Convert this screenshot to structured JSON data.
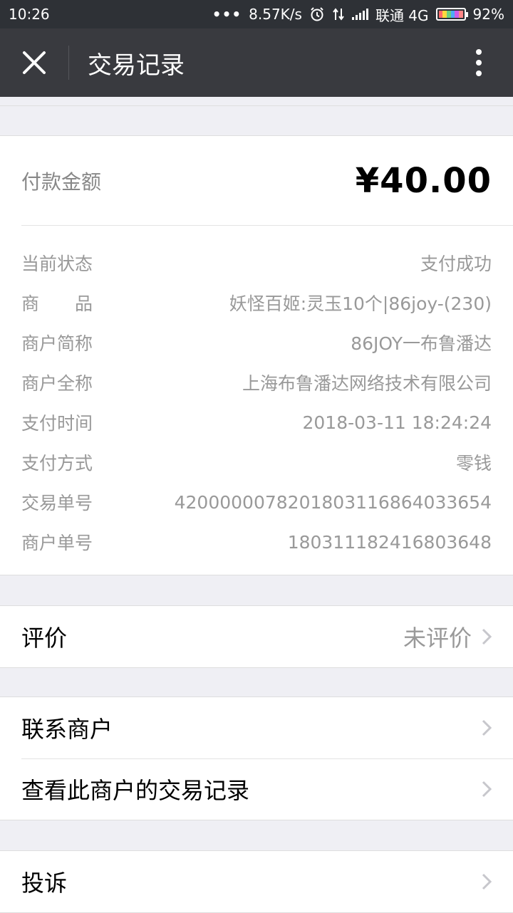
{
  "status_bar": {
    "time": "10:26",
    "dots": "•••",
    "speed": "8.57K/s",
    "carrier": "联通 4G",
    "battery": "92%"
  },
  "nav": {
    "title": "交易记录"
  },
  "amount": {
    "label": "付款金额",
    "value": "¥40.00"
  },
  "details": [
    {
      "label": "当前状态",
      "value": "支付成功"
    },
    {
      "label": "商品",
      "value": "妖怪百姬:灵玉10个|86joy-(230)"
    },
    {
      "label": "商户简称",
      "value": "86JOY一布鲁潘达"
    },
    {
      "label": "商户全称",
      "value": "上海布鲁潘达网络技术有限公司"
    },
    {
      "label": "支付时间",
      "value": "2018-03-11 18:24:24"
    },
    {
      "label": "支付方式",
      "value": "零钱"
    },
    {
      "label": "交易单号",
      "value": "4200000078201803116864033654"
    },
    {
      "label": "商户单号",
      "value": "180311182416803648"
    }
  ],
  "rating": {
    "label": "评价",
    "value": "未评价"
  },
  "contact_merchant": {
    "label": "联系商户"
  },
  "merchant_records": {
    "label": "查看此商户的交易记录"
  },
  "complaint": {
    "label": "投诉"
  },
  "colors": {
    "nav_bg": "#393a3f",
    "status_bg": "#2e3136",
    "page_bg": "#efeff4",
    "muted_text": "#999999"
  }
}
